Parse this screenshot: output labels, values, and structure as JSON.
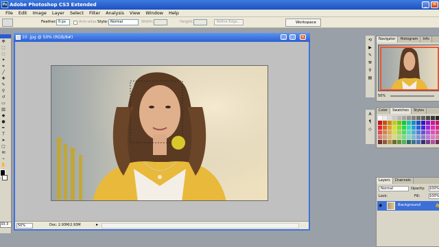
{
  "app": {
    "title": "Adobe Photoshop CS3 Extended"
  },
  "menu": [
    "File",
    "Edit",
    "Image",
    "Layer",
    "Select",
    "Filter",
    "Analysis",
    "View",
    "Window",
    "Help"
  ],
  "options": {
    "feather_label": "Feather:",
    "feather_value": "0 px",
    "antialias_label": "Anti-alias",
    "style_label": "Style:",
    "style_value": "Normal",
    "width_label": "Width:",
    "height_label": "Height:",
    "refine_label": "Refine Edge...",
    "workspace_label": "Workspace"
  },
  "toolbox": {
    "zoom": "33.3"
  },
  "document": {
    "title": "10 .jpg @ 50% (RGB/8#)",
    "zoom": "50%",
    "doc_info": "Doc: 2.93M/2.93M"
  },
  "navigator": {
    "tabs": [
      "Navigator",
      "Histogram",
      "Info"
    ],
    "zoom": "50%"
  },
  "color_panel": {
    "tabs": [
      "Color",
      "Swatches",
      "Styles"
    ]
  },
  "layers": {
    "tabs": [
      "Layers",
      "Channels"
    ],
    "mode": "Normal",
    "opacity_label": "Opacity:",
    "opacity_value": "100%",
    "lock_label": "Lock:",
    "fill_label": "Fill:",
    "fill_value": "100%",
    "layer_name": "Background"
  },
  "colors": {
    "accent": "#2a5bd6",
    "highlight": "#e8c93a"
  }
}
